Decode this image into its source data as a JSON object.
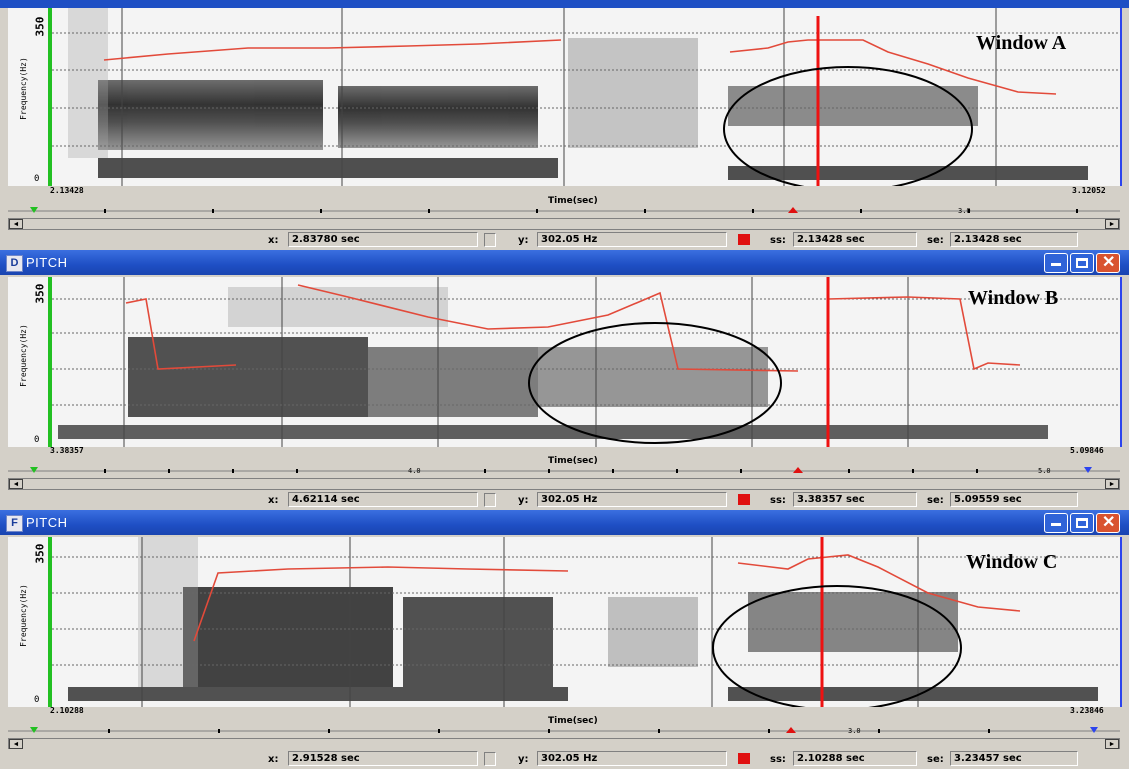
{
  "windows": {
    "A": {
      "overlay_label": "Window A",
      "title": "",
      "axis": {
        "y_max": "350",
        "y_min": "0",
        "y_label": "Frequency(Hz)",
        "x_start": "2.13428",
        "x_end": "3.12052",
        "x_label": "Time(sec)",
        "ruler_mark": "3.0"
      },
      "status": {
        "x_label": "x:",
        "x_value": "2.83780 sec",
        "y_label": "y:",
        "y_value": "302.05 Hz",
        "ss_label": "ss:",
        "ss_value": "2.13428 sec",
        "se_label": "se:",
        "se_value": "2.13428 sec"
      }
    },
    "B": {
      "overlay_label": "Window B",
      "title": "PITCH",
      "title_icon": "D",
      "axis": {
        "y_max": "350",
        "y_min": "0",
        "y_label": "Frequency(Hz)",
        "x_start": "3.38357",
        "x_end": "5.09846",
        "x_label": "Time(sec)",
        "ruler_mark": "4.0",
        "ruler_mark2": "5.0"
      },
      "status": {
        "x_label": "x:",
        "x_value": "4.62114 sec",
        "y_label": "y:",
        "y_value": "302.05 Hz",
        "ss_label": "ss:",
        "ss_value": "3.38357 sec",
        "se_label": "se:",
        "se_value": "5.09559 sec"
      }
    },
    "C": {
      "overlay_label": "Window C",
      "title": "PITCH",
      "title_icon": "F",
      "axis": {
        "y_max": "350",
        "y_min": "0",
        "y_label": "Frequency(Hz)",
        "x_start": "2.10288",
        "x_end": "3.23846",
        "x_label": "Time(sec)",
        "ruler_mark": "3.0"
      },
      "status": {
        "x_label": "x:",
        "x_value": "2.91528 sec",
        "y_label": "y:",
        "y_value": "302.05 Hz",
        "ss_label": "ss:",
        "ss_value": "2.10288 sec",
        "se_label": "se:",
        "se_value": "3.23457 sec"
      }
    }
  },
  "colors": {
    "pitch_line": "#e24a3a",
    "cursor": "#ee1111",
    "title_bar": "#1e4fc4",
    "close_button": "#d9532f",
    "selection": "#e01010"
  },
  "icons": {
    "minimize": "minimize-icon",
    "maximize": "maximize-icon",
    "close": "close-icon",
    "scroll_left": "arrow-left-icon",
    "scroll_right": "arrow-right-icon"
  }
}
